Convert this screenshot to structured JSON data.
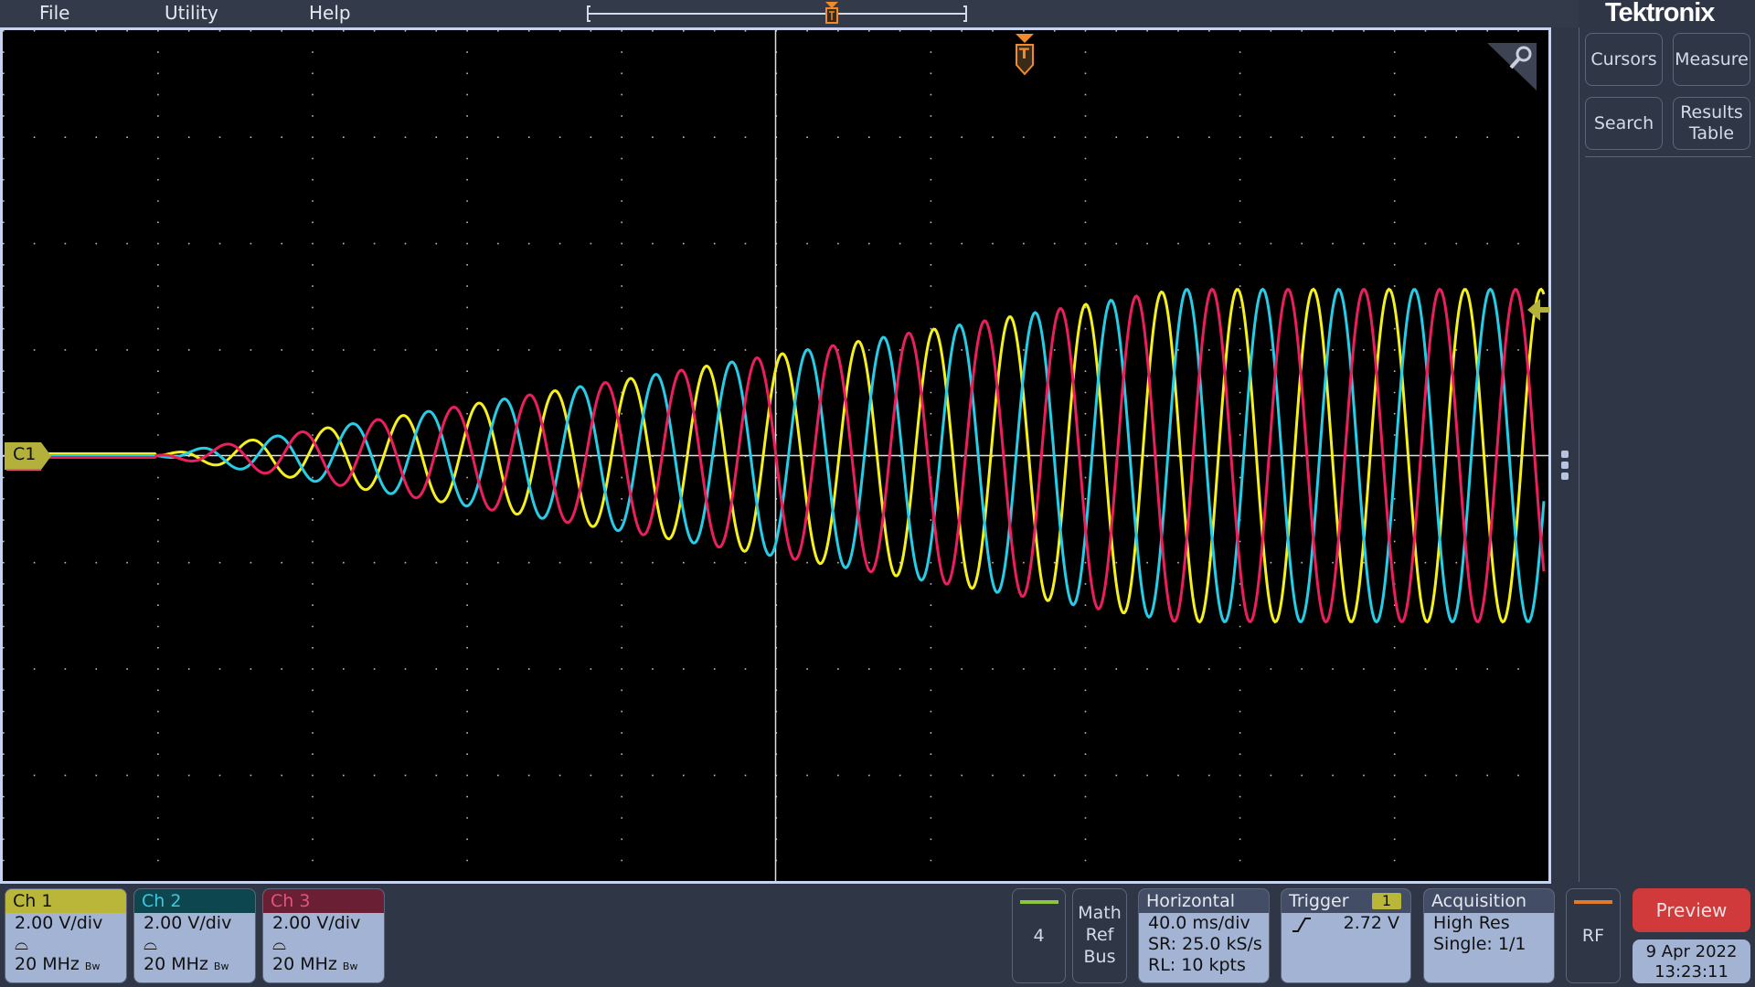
{
  "menu": {
    "items": [
      {
        "label": "File"
      },
      {
        "label": "Utility"
      },
      {
        "label": "Help"
      }
    ]
  },
  "brand": {
    "logo": "Tektronix"
  },
  "side_buttons": [
    {
      "label": "Cursors"
    },
    {
      "label": "Measure"
    },
    {
      "label": "Search"
    },
    {
      "label": "Results Table"
    }
  ],
  "plot": {
    "trigger_marker": "T",
    "channel_marker": "C1",
    "grid": {
      "h_divisions": 10,
      "v_divisions": 8
    }
  },
  "channels": [
    {
      "label": "Ch 1",
      "scale": "2.00 V/div",
      "bandwidth": "20 MHz",
      "bw_mark": "Bw",
      "header_color": "#b9b63a",
      "text_color": "#111111",
      "trace_color": "#f5f01e"
    },
    {
      "label": "Ch 2",
      "scale": "2.00 V/div",
      "bandwidth": "20 MHz",
      "bw_mark": "Bw",
      "header_color": "#0e4650",
      "text_color": "#3cc8dc",
      "trace_color": "#27cde6"
    },
    {
      "label": "Ch 3",
      "scale": "2.00 V/div",
      "bandwidth": "20 MHz",
      "bw_mark": "Bw",
      "header_color": "#6a1f35",
      "text_color": "#e0557f",
      "trace_color": "#ec1f5e"
    }
  ],
  "add_channel": {
    "label": "4",
    "color": "#8cc63f"
  },
  "math_ref_bus": {
    "line1": "Math",
    "line2": "Ref",
    "line3": "Bus"
  },
  "horizontal": {
    "title": "Horizontal",
    "scale": "40.0 ms/div",
    "sample_rate": "SR: 25.0 kS/s",
    "record_length": "RL: 10 kpts"
  },
  "trigger": {
    "title": "Trigger",
    "source": "1",
    "slope": "rising",
    "level": "2.72 V"
  },
  "acquisition": {
    "title": "Acquisition",
    "mode": "High Res",
    "status": "Single: 1/1"
  },
  "rf": {
    "label": "RF",
    "color": "#e07b2e"
  },
  "preview": {
    "label": "Preview",
    "color": "#d03a3a"
  },
  "datetime": {
    "date": "9 Apr 2022",
    "time": "13:23:11"
  }
}
